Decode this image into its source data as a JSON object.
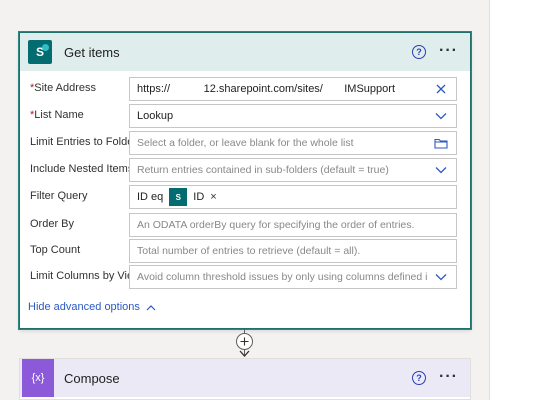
{
  "get_items": {
    "title": "Get items",
    "help_glyph": "?",
    "more_glyph": "···",
    "fields": [
      {
        "label": "Site Address",
        "required": true,
        "value": "https://           12.sharepoint.com/sites/       IMSupport",
        "icon": "clear-icon"
      },
      {
        "label": "List Name",
        "required": true,
        "value": "Lookup",
        "icon": "chevron-down-icon"
      },
      {
        "label": "Limit Entries to Folder",
        "required": false,
        "placeholder": "Select a folder, or leave blank for the whole list",
        "icon": "folder-icon"
      },
      {
        "label": "Include Nested Items",
        "required": false,
        "placeholder": "Return entries contained in sub-folders (default = true)",
        "icon": "chevron-down-icon"
      },
      {
        "label": "Filter Query",
        "required": false,
        "value": "ID eq",
        "token": {
          "label": "ID",
          "remove": "×"
        }
      },
      {
        "label": "Order By",
        "required": false,
        "placeholder": "An ODATA orderBy query for specifying the order of entries."
      },
      {
        "label": "Top Count",
        "required": false,
        "placeholder": "Total number of entries to retrieve (default = all)."
      },
      {
        "label": "Limit Columns by View",
        "required": false,
        "placeholder": "Avoid column threshold issues by only using columns defined in a view",
        "icon": "chevron-down-icon"
      }
    ],
    "required_mark": "*",
    "advanced_link": "Hide advanced options"
  },
  "connector": {
    "plus": "+"
  },
  "compose": {
    "title": "Compose",
    "icon_glyph": "{x}",
    "help_glyph": "?",
    "more_glyph": "···"
  },
  "colors": {
    "sharepoint": "#036c70",
    "compose": "#8c5ad9",
    "link": "#2b59c3",
    "required": "#a4262c"
  }
}
